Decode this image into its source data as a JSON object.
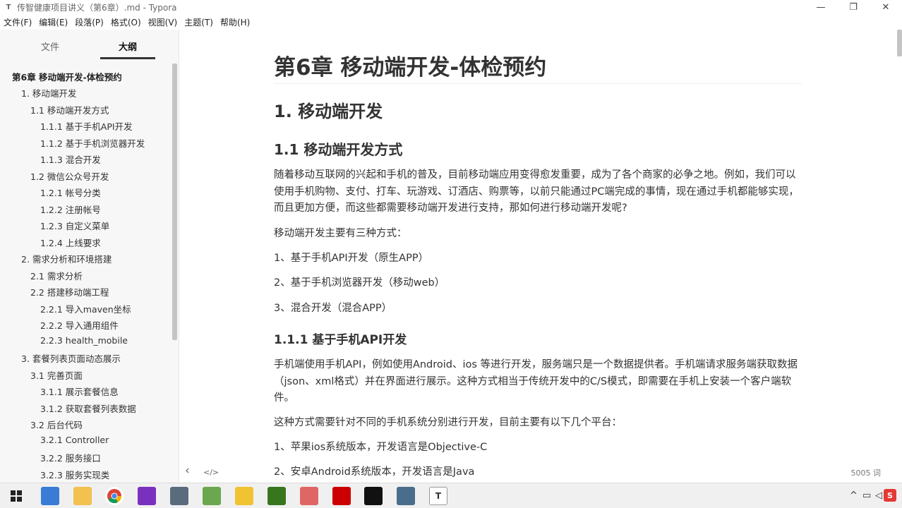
{
  "window": {
    "title": "传智健康项目讲义（第6章）.md - Typora",
    "app_icon": "T",
    "minimize_icon": "—",
    "restore_icon": "❐",
    "close_icon": "✕"
  },
  "menubar": {
    "items": [
      "文件(F)",
      "编辑(E)",
      "段落(P)",
      "格式(O)",
      "视图(V)",
      "主题(T)",
      "帮助(H)"
    ]
  },
  "sidebar": {
    "tabs": {
      "files": "文件",
      "outline": "大纲"
    },
    "outline": [
      "第6章 移动端开发-体检预约",
      "1. 移动端开发",
      "1.1 移动端开发方式",
      "1.1.1 基于手机API开发",
      "1.1.2 基于手机浏览器开发",
      "1.1.3 混合开发",
      "1.2 微信公众号开发",
      "1.2.1 帐号分类",
      "1.2.2 注册帐号",
      "1.2.3 自定义菜单",
      "1.2.4 上线要求",
      "2. 需求分析和环境搭建",
      "2.1 需求分析",
      "2.2 搭建移动端工程",
      "2.2.1 导入maven坐标",
      "2.2.2 导入通用组件",
      "2.2.3 health_mobile",
      "3. 套餐列表页面动态展示",
      "3.1 完善页面",
      "3.1.1 展示套餐信息",
      "3.1.2 获取套餐列表数据",
      "3.2 后台代码",
      "3.2.1 Controller",
      "3.2.2 服务接口",
      "3.2.3 服务实现类"
    ]
  },
  "doc": {
    "h1": "第6章 移动端开发-体检预约",
    "h2": "1. 移动端开发",
    "h3": "1.1 移动端开发方式",
    "p1": "随着移动互联网的兴起和手机的普及，目前移动端应用变得愈发重要，成为了各个商家的必争之地。例如，我们可以使用手机购物、支付、打车、玩游戏、订酒店、购票等，以前只能通过PC端完成的事情，现在通过手机都能够实现，而且更加方便，而这些都需要移动端开发进行支持，那如何进行移动端开发呢?",
    "p2": "移动端开发主要有三种方式：",
    "p3": "1、基于手机API开发（原生APP）",
    "p4": "2、基于手机浏览器开发（移动web）",
    "p5": "3、混合开发（混合APP）",
    "h4": "1.1.1 基于手机API开发",
    "p6": "手机端使用手机API，例如使用Android、ios 等进行开发，服务端只是一个数据提供者。手机端请求服务端获取数据（json、xml格式）并在界面进行展示。这种方式相当于传统开发中的C/S模式，即需要在手机上安装一个客户端软件。",
    "p7": "这种方式需要针对不同的手机系统分别进行开发，目前主要有以下几个平台：",
    "p8": "1、苹果ios系统版本，开发语言是Objective-C",
    "p9": "2、安卓Android系统版本，开发语言是Java"
  },
  "statusbar": {
    "back_icon": "‹",
    "source_icon": "</>",
    "word_count": "5005 词"
  },
  "taskbar": {
    "tray_up": "^",
    "tray_ime": "S"
  }
}
